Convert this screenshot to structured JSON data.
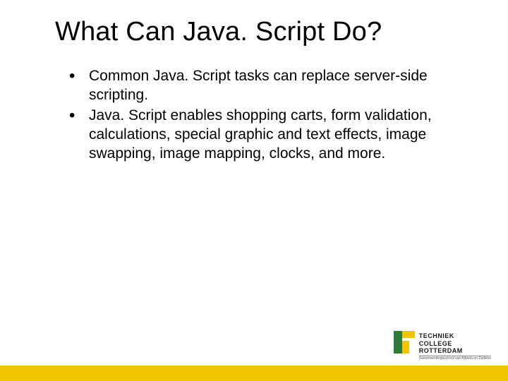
{
  "title": "What Can Java. Script Do?",
  "bullets": [
    "Common Java. Script tasks can replace server-side scripting.",
    "Java. Script enables shopping carts, form validation, calculations, special graphic and text effects, image swapping, image mapping, clocks, and more."
  ],
  "logo": {
    "line1": "TECHNIEK",
    "line2": "COLLEGE",
    "line3": "ROTTERDAM",
    "sub": "Samenwerkingsschool van Albeda en Zadkine"
  },
  "colors": {
    "accent_yellow": "#f0c400",
    "accent_green": "#2d7a3a"
  }
}
